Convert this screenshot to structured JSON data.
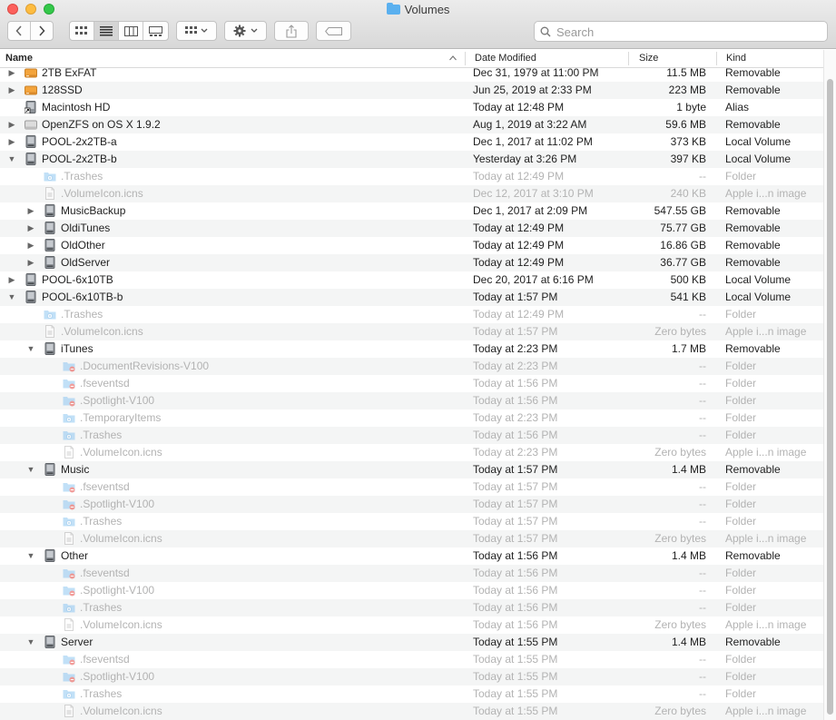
{
  "window": {
    "title": "Volumes"
  },
  "toolbar": {
    "back_icon": "chevron-left",
    "forward_icon": "chevron-right",
    "search_placeholder": "Search"
  },
  "columns": {
    "name": "Name",
    "date": "Date Modified",
    "size": "Size",
    "kind": "Kind"
  },
  "rows": [
    {
      "level": 0,
      "disclosure": "closed",
      "icon": "drive-orange",
      "name": "2TB ExFAT",
      "date": "Dec 31, 1979 at 11:00 PM",
      "size": "11.5 MB",
      "kind": "Removable",
      "dim": false
    },
    {
      "level": 0,
      "disclosure": "closed",
      "icon": "drive-orange",
      "name": "128SSD",
      "date": "Jun 25, 2019 at 2:33 PM",
      "size": "223 MB",
      "kind": "Removable",
      "dim": false
    },
    {
      "level": 0,
      "disclosure": "none",
      "icon": "drive-alias",
      "name": "Macintosh HD",
      "date": "Today at 12:48 PM",
      "size": "1 byte",
      "kind": "Alias",
      "dim": false
    },
    {
      "level": 0,
      "disclosure": "closed",
      "icon": "drive-gray",
      "name": "OpenZFS on OS X 1.9.2",
      "date": "Aug 1, 2019 at 3:22 AM",
      "size": "59.6 MB",
      "kind": "Removable",
      "dim": false
    },
    {
      "level": 0,
      "disclosure": "closed",
      "icon": "drive",
      "name": "POOL-2x2TB-a",
      "date": "Dec 1, 2017 at 11:02 PM",
      "size": "373 KB",
      "kind": "Local Volume",
      "dim": false
    },
    {
      "level": 0,
      "disclosure": "open",
      "icon": "drive",
      "name": "POOL-2x2TB-b",
      "date": "Yesterday at 3:26 PM",
      "size": "397 KB",
      "kind": "Local Volume",
      "dim": false
    },
    {
      "level": 1,
      "disclosure": "none",
      "icon": "folder",
      "name": ".Trashes",
      "date": "Today at 12:49 PM",
      "size": "--",
      "kind": "Folder",
      "dim": true
    },
    {
      "level": 1,
      "disclosure": "none",
      "icon": "doc",
      "name": ".VolumeIcon.icns",
      "date": "Dec 12, 2017 at 3:10 PM",
      "size": "240 KB",
      "kind": "Apple i...n image",
      "dim": true
    },
    {
      "level": 1,
      "disclosure": "closed",
      "icon": "drive",
      "name": "MusicBackup",
      "date": "Dec 1, 2017 at 2:09 PM",
      "size": "547.55 GB",
      "kind": "Removable",
      "dim": false
    },
    {
      "level": 1,
      "disclosure": "closed",
      "icon": "drive",
      "name": "OldiTunes",
      "date": "Today at 12:49 PM",
      "size": "75.77 GB",
      "kind": "Removable",
      "dim": false
    },
    {
      "level": 1,
      "disclosure": "closed",
      "icon": "drive",
      "name": "OldOther",
      "date": "Today at 12:49 PM",
      "size": "16.86 GB",
      "kind": "Removable",
      "dim": false
    },
    {
      "level": 1,
      "disclosure": "closed",
      "icon": "drive",
      "name": "OldServer",
      "date": "Today at 12:49 PM",
      "size": "36.77 GB",
      "kind": "Removable",
      "dim": false
    },
    {
      "level": 0,
      "disclosure": "closed",
      "icon": "drive",
      "name": "POOL-6x10TB",
      "date": "Dec 20, 2017 at 6:16 PM",
      "size": "500 KB",
      "kind": "Local Volume",
      "dim": false
    },
    {
      "level": 0,
      "disclosure": "open",
      "icon": "drive",
      "name": "POOL-6x10TB-b",
      "date": "Today at 1:57 PM",
      "size": "541 KB",
      "kind": "Local Volume",
      "dim": false
    },
    {
      "level": 1,
      "disclosure": "none",
      "icon": "folder",
      "name": ".Trashes",
      "date": "Today at 12:49 PM",
      "size": "--",
      "kind": "Folder",
      "dim": true
    },
    {
      "level": 1,
      "disclosure": "none",
      "icon": "doc",
      "name": ".VolumeIcon.icns",
      "date": "Today at 1:57 PM",
      "size": "Zero bytes",
      "kind": "Apple i...n image",
      "dim": true
    },
    {
      "level": 1,
      "disclosure": "open",
      "icon": "drive",
      "name": "iTunes",
      "date": "Today at 2:23 PM",
      "size": "1.7 MB",
      "kind": "Removable",
      "dim": false
    },
    {
      "level": 2,
      "disclosure": "none",
      "icon": "folder-restricted",
      "name": ".DocumentRevisions-V100",
      "date": "Today at 2:23 PM",
      "size": "--",
      "kind": "Folder",
      "dim": true
    },
    {
      "level": 2,
      "disclosure": "none",
      "icon": "folder-restricted",
      "name": ".fseventsd",
      "date": "Today at 1:56 PM",
      "size": "--",
      "kind": "Folder",
      "dim": true
    },
    {
      "level": 2,
      "disclosure": "none",
      "icon": "folder-restricted",
      "name": ".Spotlight-V100",
      "date": "Today at 1:56 PM",
      "size": "--",
      "kind": "Folder",
      "dim": true
    },
    {
      "level": 2,
      "disclosure": "none",
      "icon": "folder",
      "name": ".TemporaryItems",
      "date": "Today at 2:23 PM",
      "size": "--",
      "kind": "Folder",
      "dim": true
    },
    {
      "level": 2,
      "disclosure": "none",
      "icon": "folder",
      "name": ".Trashes",
      "date": "Today at 1:56 PM",
      "size": "--",
      "kind": "Folder",
      "dim": true
    },
    {
      "level": 2,
      "disclosure": "none",
      "icon": "doc",
      "name": ".VolumeIcon.icns",
      "date": "Today at 2:23 PM",
      "size": "Zero bytes",
      "kind": "Apple i...n image",
      "dim": true
    },
    {
      "level": 1,
      "disclosure": "open",
      "icon": "drive",
      "name": "Music",
      "date": "Today at 1:57 PM",
      "size": "1.4 MB",
      "kind": "Removable",
      "dim": false
    },
    {
      "level": 2,
      "disclosure": "none",
      "icon": "folder-restricted",
      "name": ".fseventsd",
      "date": "Today at 1:57 PM",
      "size": "--",
      "kind": "Folder",
      "dim": true
    },
    {
      "level": 2,
      "disclosure": "none",
      "icon": "folder-restricted",
      "name": ".Spotlight-V100",
      "date": "Today at 1:57 PM",
      "size": "--",
      "kind": "Folder",
      "dim": true
    },
    {
      "level": 2,
      "disclosure": "none",
      "icon": "folder",
      "name": ".Trashes",
      "date": "Today at 1:57 PM",
      "size": "--",
      "kind": "Folder",
      "dim": true
    },
    {
      "level": 2,
      "disclosure": "none",
      "icon": "doc",
      "name": ".VolumeIcon.icns",
      "date": "Today at 1:57 PM",
      "size": "Zero bytes",
      "kind": "Apple i...n image",
      "dim": true
    },
    {
      "level": 1,
      "disclosure": "open",
      "icon": "drive",
      "name": "Other",
      "date": "Today at 1:56 PM",
      "size": "1.4 MB",
      "kind": "Removable",
      "dim": false
    },
    {
      "level": 2,
      "disclosure": "none",
      "icon": "folder-restricted",
      "name": ".fseventsd",
      "date": "Today at 1:56 PM",
      "size": "--",
      "kind": "Folder",
      "dim": true
    },
    {
      "level": 2,
      "disclosure": "none",
      "icon": "folder-restricted",
      "name": ".Spotlight-V100",
      "date": "Today at 1:56 PM",
      "size": "--",
      "kind": "Folder",
      "dim": true
    },
    {
      "level": 2,
      "disclosure": "none",
      "icon": "folder",
      "name": ".Trashes",
      "date": "Today at 1:56 PM",
      "size": "--",
      "kind": "Folder",
      "dim": true
    },
    {
      "level": 2,
      "disclosure": "none",
      "icon": "doc",
      "name": ".VolumeIcon.icns",
      "date": "Today at 1:56 PM",
      "size": "Zero bytes",
      "kind": "Apple i...n image",
      "dim": true
    },
    {
      "level": 1,
      "disclosure": "open",
      "icon": "drive",
      "name": "Server",
      "date": "Today at 1:55 PM",
      "size": "1.4 MB",
      "kind": "Removable",
      "dim": false
    },
    {
      "level": 2,
      "disclosure": "none",
      "icon": "folder-restricted",
      "name": ".fseventsd",
      "date": "Today at 1:55 PM",
      "size": "--",
      "kind": "Folder",
      "dim": true
    },
    {
      "level": 2,
      "disclosure": "none",
      "icon": "folder-restricted",
      "name": ".Spotlight-V100",
      "date": "Today at 1:55 PM",
      "size": "--",
      "kind": "Folder",
      "dim": true
    },
    {
      "level": 2,
      "disclosure": "none",
      "icon": "folder",
      "name": ".Trashes",
      "date": "Today at 1:55 PM",
      "size": "--",
      "kind": "Folder",
      "dim": true
    },
    {
      "level": 2,
      "disclosure": "none",
      "icon": "doc",
      "name": ".VolumeIcon.icns",
      "date": "Today at 1:55 PM",
      "size": "Zero bytes",
      "kind": "Apple i...n image",
      "dim": true
    }
  ]
}
